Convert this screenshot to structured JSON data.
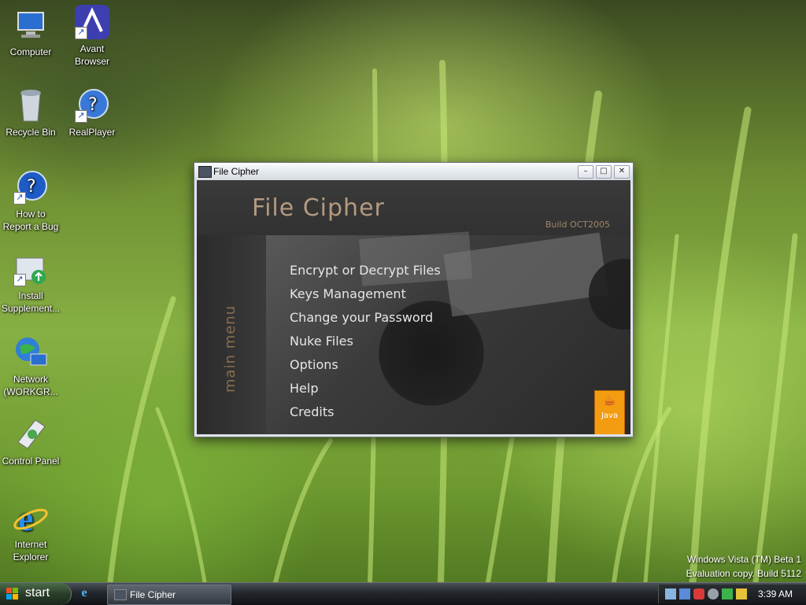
{
  "desktop": {
    "icons": [
      {
        "label": "Computer"
      },
      {
        "label": "Avant\nBrowser"
      },
      {
        "label": "Recycle Bin"
      },
      {
        "label": "RealPlayer"
      },
      {
        "label": "How to\nReport a Bug"
      },
      {
        "label": "Install\nSupplement..."
      },
      {
        "label": "Network\n(WORKGR..."
      },
      {
        "label": "Control Panel"
      },
      {
        "label": "Internet\nExplorer"
      }
    ],
    "watermark": {
      "line1": "Windows Vista (TM) Beta 1",
      "line2": "Evaluation copy. Build 5112"
    }
  },
  "window": {
    "title": "File Cipher",
    "controls": {
      "minimize": "–",
      "maximize": "□",
      "close": "✕"
    },
    "app_title": "File Cipher",
    "build": "Build OCT2005",
    "side_title": "main menu",
    "menu": [
      "Encrypt or Decrypt Files",
      "Keys Management",
      "Change your Password",
      "Nuke Files",
      "Options",
      "Help",
      "Credits"
    ],
    "java_logo_text": "Java"
  },
  "taskbar": {
    "start_label": "start",
    "task_label": "File Cipher",
    "clock": "3:39 AM"
  },
  "colors": {
    "accent_text": "#b49a80",
    "menu_text": "#e6e6e6",
    "taskbar": "#16191c"
  }
}
